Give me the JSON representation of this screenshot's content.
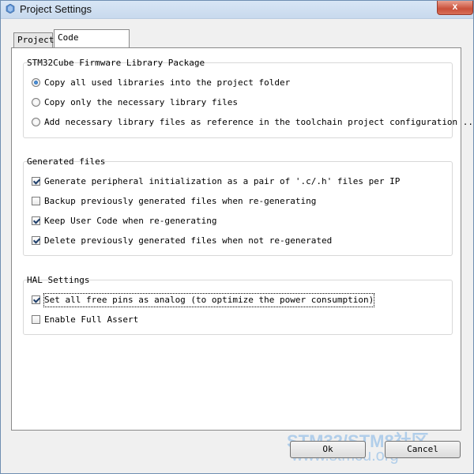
{
  "window": {
    "title": "Project Settings",
    "close_icon": "close-icon",
    "app_icon": "app-icon",
    "close_glyph": "x"
  },
  "tabs": [
    {
      "label": "Project",
      "active": false
    },
    {
      "label": "Code Generator",
      "active": true
    }
  ],
  "groups": {
    "firmware": {
      "title": "STM32Cube Firmware Library Package",
      "options": [
        {
          "label": "Copy all used libraries into the project folder",
          "selected": true
        },
        {
          "label": "Copy only the necessary library files",
          "selected": false
        },
        {
          "label": "Add necessary library files as reference in the toolchain project configuration ...",
          "selected": false
        }
      ]
    },
    "generated": {
      "title": "Generated files",
      "options": [
        {
          "label": "Generate peripheral initialization as a pair of '.c/.h' files per IP",
          "checked": true
        },
        {
          "label": "Backup previously generated files when re-generating",
          "checked": false
        },
        {
          "label": "Keep User Code when re-generating",
          "checked": true
        },
        {
          "label": "Delete previously generated files when not re-generated",
          "checked": true
        }
      ]
    },
    "hal": {
      "title": "HAL Settings",
      "options": [
        {
          "label": "Set all free pins as analog (to optimize the power consumption)",
          "checked": true
        },
        {
          "label": "Enable Full Assert",
          "checked": false
        }
      ]
    }
  },
  "buttons": {
    "ok": "Ok",
    "cancel": "Cancel"
  },
  "watermark": {
    "line1": "STM32/STM8社区",
    "line2": "www.stmcu.org"
  },
  "colors": {
    "accent": "#1c5aa0",
    "watermark": "#9cc3e8",
    "close": "#c9503a"
  }
}
